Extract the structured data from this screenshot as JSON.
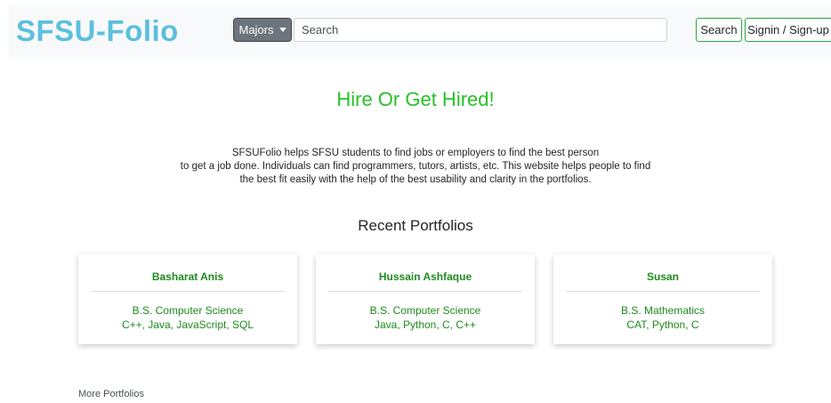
{
  "navbar": {
    "brand": "SFSU-Folio",
    "majors_label": "Majors",
    "search_placeholder": "Search",
    "search_button": "Search",
    "signin_button": "Signin / Sign-up"
  },
  "hero": {
    "headline": "Hire Or Get Hired!",
    "intro_lines": [
      "SFSUFolio helps SFSU students to find jobs or employers to find the best person",
      "to get a job done. Individuals can find programmers, tutors, artists, etc. This website helps people to find",
      "the best fit easily with the help of the best usability and clarity in the portfolios."
    ]
  },
  "portfolios": {
    "title": "Recent Portfolios",
    "cards": [
      {
        "name": "Basharat Anis",
        "degree": "B.S. Computer Science",
        "skills": "C++, Java, JavaScript, SQL"
      },
      {
        "name": "Hussain Ashfaque",
        "degree": "B.S. Computer Science",
        "skills": "Java, Python, C, C++"
      },
      {
        "name": "Susan",
        "degree": "B.S. Mathematics",
        "skills": "CAT, Python, C"
      }
    ],
    "more_link": "More Portfolios"
  },
  "colors": {
    "brand": "#5bc0de",
    "headline": "#28c128",
    "card_text": "#1e8a1e",
    "outline_button_border": "#28a745"
  }
}
